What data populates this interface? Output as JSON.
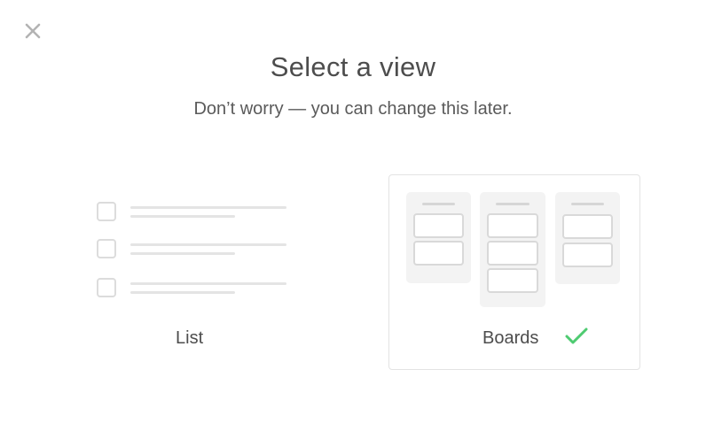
{
  "dialog": {
    "title": "Select a view",
    "subtitle": "Don’t worry — you can change this later."
  },
  "options": [
    {
      "id": "list",
      "label": "List",
      "selected": false
    },
    {
      "id": "boards",
      "label": "Boards",
      "selected": true
    }
  ],
  "colors": {
    "text": "#4d4d4d",
    "placeholder": "#e4e4e4",
    "selected_border": "#e3e3e3",
    "check": "#4ecb71"
  },
  "icons": {
    "close": "close-icon",
    "selected": "checkmark-icon"
  }
}
